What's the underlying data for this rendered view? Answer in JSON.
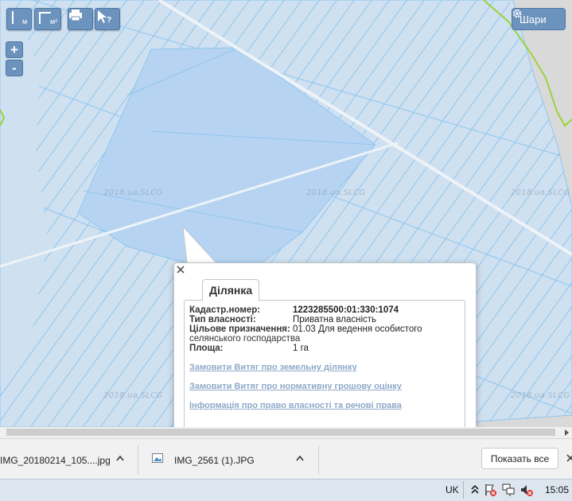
{
  "toolbar": {
    "ruler_m_label": "м",
    "ruler_area_label": "м²",
    "layers_label": "Шари",
    "zoom_in": "+",
    "zoom_out": "-"
  },
  "map": {
    "watermark": "2018.ua.SLCG",
    "parcel_fill": "#cfe0f0",
    "parcel_stroke": "#8ec6ee",
    "highlight_fill": "#b6d4f1",
    "boundary_color": "#9ad33a"
  },
  "popup": {
    "tab_title": "Ділянка",
    "fields": [
      {
        "label": "Кадастр.номер:",
        "value": "1223285500:01:330:1074"
      },
      {
        "label": "Тип власності:",
        "value": "Приватна власність"
      },
      {
        "label": "Цільове призначення:",
        "value": "01.03 Для ведення особистого"
      },
      {
        "label": "",
        "value": "селянського господарства"
      },
      {
        "label": "Площа:",
        "value": "1 га"
      }
    ],
    "links": [
      "Замовити Витяг про земельну ділянку",
      "Замовити Витяг про нормативну грошову оцінку",
      "Інформація про право власності та речові права"
    ]
  },
  "downloads": {
    "items": [
      {
        "name": "IMG_20180214_105....jpg"
      },
      {
        "name": "IMG_2561 (1).JPG"
      }
    ],
    "show_all": "Показать все"
  },
  "taskbar": {
    "language": "UK",
    "time": "15:05"
  }
}
